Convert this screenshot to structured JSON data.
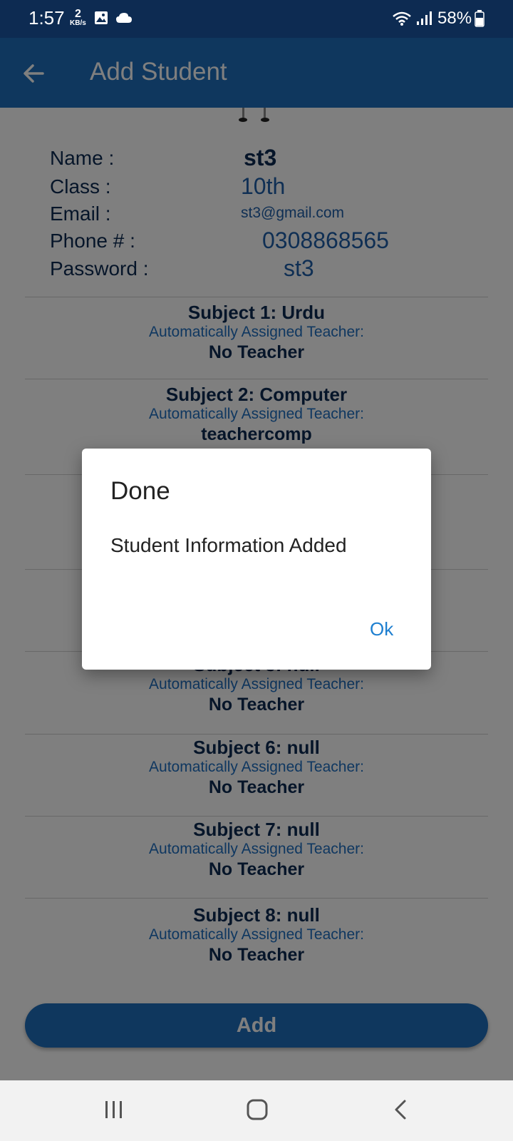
{
  "status_bar": {
    "time": "1:57",
    "speed_value": "2",
    "speed_unit": "KB/s",
    "battery": "58%",
    "icons": [
      "image-icon",
      "cloud-icon",
      "wifi-icon",
      "signal-icon",
      "battery-icon"
    ]
  },
  "app_bar": {
    "title": "Add Student",
    "back_icon": "arrow-left-icon"
  },
  "student": {
    "name_label": "Name :",
    "name_value": "st3",
    "class_label": "Class :",
    "class_value": "10th",
    "email_label": "Email :",
    "email_value": "st3@gmail.com",
    "phone_label": "Phone # :",
    "phone_value": "0308868565",
    "password_label": "Password :",
    "password_value": "st3"
  },
  "subjects": [
    {
      "title": "Subject 1:  Urdu",
      "auto": "Automatically Assigned Teacher:",
      "teacher": "No Teacher"
    },
    {
      "title": "Subject 2:  Computer",
      "auto": "Automatically Assigned Teacher:",
      "teacher": "teachercomp"
    },
    {
      "title": "Subject 5:  null",
      "auto": "Automatically Assigned Teacher:",
      "teacher": "No Teacher"
    },
    {
      "title": "Subject 6:  null",
      "auto": "Automatically Assigned Teacher:",
      "teacher": "No Teacher"
    },
    {
      "title": "Subject 7:  null",
      "auto": "Automatically Assigned Teacher:",
      "teacher": "No Teacher"
    },
    {
      "title": "Subject 8:  null",
      "auto": "Automatically Assigned Teacher:",
      "teacher": "No Teacher"
    }
  ],
  "add_button_label": "Add",
  "dialog": {
    "title": "Done",
    "message": "Student Information Added",
    "ok_label": "Ok"
  },
  "nav_bar": {
    "icons": [
      "recent-apps-icon",
      "home-icon",
      "back-icon"
    ]
  },
  "colors": {
    "status_bar": "#0d2b52",
    "app_bar": "#1e6fbd",
    "label_text": "#0d2b52",
    "value_text": "#1f5fa9",
    "dialog_button": "#1e7fd0"
  }
}
